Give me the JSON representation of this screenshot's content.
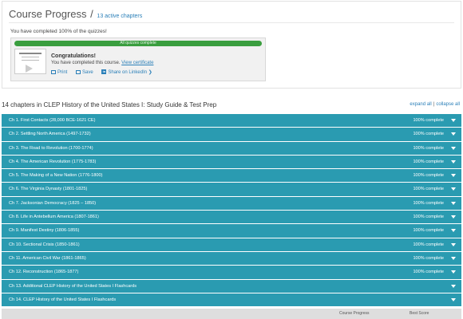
{
  "progress_card": {
    "title": "Course Progress",
    "separator": "/",
    "link": "13 active chapters",
    "quiz_text": "You have completed 100% of the quizzes!",
    "bar": {
      "label": "All quizzes complete",
      "fraction": 1.0,
      "color": "#3a9e3f"
    },
    "congrats": "Congratulations!",
    "completed_text": "You have completed this course.",
    "certificate_link": "View certificate",
    "actions": {
      "print": "Print",
      "save": "Save",
      "linkedin": "Share on LinkedIn ❯"
    }
  },
  "chapters_header": {
    "title": "14 chapters in CLEP History of the United States I: Study Guide & Test Prep",
    "expand_all": "expand all",
    "pipe": "|",
    "collapse_all": "collapse all"
  },
  "colors": {
    "row": "#2a9bb1",
    "link": "#2a7fb8"
  },
  "chapters": [
    {
      "label": "Ch 1. First Contacts (28,000 BCE-1621 CE)",
      "status": "100% complete"
    },
    {
      "label": "Ch 2. Settling North America (1497-1732)",
      "status": "100% complete"
    },
    {
      "label": "Ch 3. The Road to Revolution (1700-1774)",
      "status": "100% complete"
    },
    {
      "label": "Ch 4. The American Revolution (1775-1783)",
      "status": "100% complete"
    },
    {
      "label": "Ch 5. The Making of a New Nation (1776-1800)",
      "status": "100% complete"
    },
    {
      "label": "Ch 6. The Virginia Dynasty (1801-1825)",
      "status": "100% complete"
    },
    {
      "label": "Ch 7. Jacksonian Democracy (1825 – 1850)",
      "status": "100% complete"
    },
    {
      "label": "Ch 8. Life in Antebellum America (1807-1861)",
      "status": "100% complete"
    },
    {
      "label": "Ch 9. Manifest Destiny (1806-1855)",
      "status": "100% complete"
    },
    {
      "label": "Ch 10. Sectional Crisis (1850-1861)",
      "status": "100% complete"
    },
    {
      "label": "Ch 11. American Civil War (1861-1865)",
      "status": "100% complete"
    },
    {
      "label": "Ch 12. Reconstruction (1865-1877)",
      "status": "100% complete"
    },
    {
      "label": "Ch 13. Additional CLEP History of the United States I Flashcards",
      "status": ""
    },
    {
      "label": "Ch 14. CLEP History of the United States I Flashcards",
      "status": ""
    }
  ],
  "footer": {
    "course_progress": "Course Progress",
    "best_score": "Best Score"
  }
}
